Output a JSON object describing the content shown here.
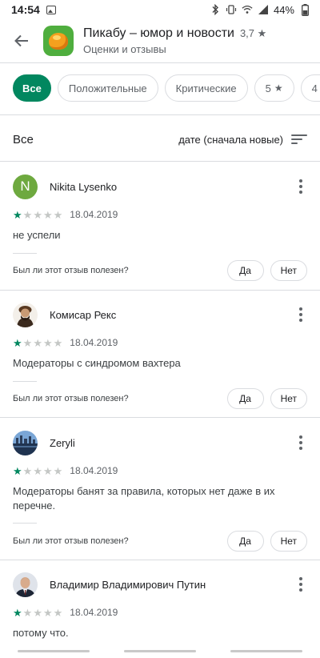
{
  "status": {
    "time": "14:54",
    "battery": "44%"
  },
  "app": {
    "title": "Пикабу – юмор и новости",
    "rating": "3,7 ★",
    "subtitle": "Оценки и отзывы",
    "icon_colors": {
      "bg": "#4fae3e",
      "blob": "#f4a01e"
    }
  },
  "filters": [
    {
      "label": "Все",
      "active": true
    },
    {
      "label": "Положительные",
      "active": false
    },
    {
      "label": "Критические",
      "active": false
    },
    {
      "label": "5",
      "star": true,
      "active": false
    },
    {
      "label": "4",
      "star": true,
      "active": false
    }
  ],
  "sort": {
    "all_label": "Все",
    "value": "дате (сначала новые)"
  },
  "reviews": [
    {
      "name": "Nikita Lysenko",
      "avatar_letter": "N",
      "stars": 1,
      "max_stars": 5,
      "date": "18.04.2019",
      "text": "не успели",
      "helpful": "Был ли этот отзыв полезен?",
      "yes": "Да",
      "no": "Нет"
    },
    {
      "name": "Комисар Рекс",
      "avatar_letter": "",
      "stars": 1,
      "max_stars": 5,
      "date": "18.04.2019",
      "text": "Модераторы с синдромом вахтера",
      "helpful": "Был ли этот отзыв полезен?",
      "yes": "Да",
      "no": "Нет"
    },
    {
      "name": "Zeryli",
      "avatar_letter": "",
      "stars": 1,
      "max_stars": 5,
      "date": "18.04.2019",
      "text": "Модераторы банят за правила, которых нет даже в их перечне.",
      "helpful": "Был ли этот отзыв полезен?",
      "yes": "Да",
      "no": "Нет"
    },
    {
      "name": "Владимир Владимирович Путин",
      "avatar_letter": "",
      "stars": 1,
      "max_stars": 5,
      "date": "18.04.2019",
      "text": "потому что.",
      "helpful": "",
      "yes": "",
      "no": ""
    }
  ],
  "colors": {
    "accent": "#01875f",
    "star_off": "#c4c7c5",
    "avatar_n": "#6ea93f"
  }
}
